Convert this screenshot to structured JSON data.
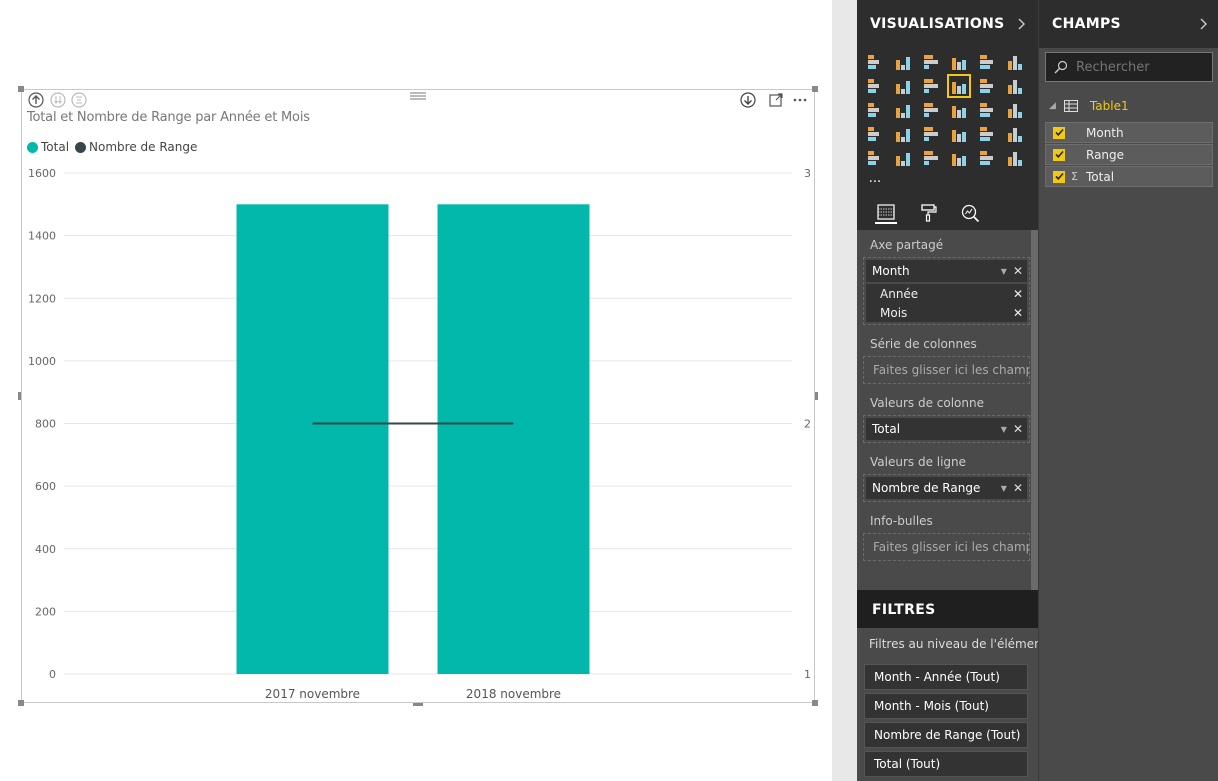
{
  "visual": {
    "title": "Total et Nombre de Range par Année et Mois",
    "legend": [
      {
        "label": "Total",
        "color": "#01b8aa"
      },
      {
        "label": "Nombre de Range",
        "color": "#374649"
      }
    ],
    "toolbar_icons": [
      "drill-up-icon",
      "drill-down-all-icon",
      "expand-all-icon",
      "drill-mode-icon",
      "focus-mode-icon",
      "more-options-icon"
    ]
  },
  "chart_data": {
    "type": "bar",
    "categories": [
      "2017 novembre",
      "2018 novembre"
    ],
    "series": [
      {
        "name": "Total",
        "type": "bar",
        "axis": "left",
        "values": [
          1500,
          1500
        ],
        "color": "#01b8aa"
      },
      {
        "name": "Nombre de Range",
        "type": "line",
        "axis": "right",
        "values": [
          2,
          2
        ],
        "color": "#374649"
      }
    ],
    "title": "Total et Nombre de Range par Année et Mois",
    "ylim": [
      0,
      1600
    ],
    "y2lim": [
      1,
      3
    ],
    "yticks": [
      "0",
      "200",
      "400",
      "600",
      "800",
      "1000",
      "1200",
      "1400",
      "1600"
    ],
    "y2ticks": [
      "1",
      "2",
      "3"
    ],
    "grid": true,
    "legend_position": "top-left"
  },
  "viz_pane": {
    "title": "VISUALISATIONS",
    "icons": [
      "stacked-bar-icon",
      "stacked-column-icon",
      "clustered-bar-icon",
      "clustered-column-icon",
      "100-bar-icon",
      "100-column-icon",
      "line-chart-icon",
      "area-chart-icon",
      "stacked-area-icon",
      "line-clustered-column-icon",
      "line-stacked-column-icon",
      "ribbon-chart-icon",
      "waterfall-icon",
      "scatter-icon",
      "pie-icon",
      "donut-icon",
      "treemap-icon",
      "map-icon",
      "filled-map-icon",
      "shape-map-icon",
      "funnel-icon",
      "gauge-icon",
      "card-icon",
      "multirow-card-icon",
      "kpi-icon",
      "slicer-icon",
      "table-icon",
      "matrix-icon",
      "r-visual-icon",
      "globe-icon"
    ],
    "more": "···",
    "selected_icon": "line-clustered-column-icon",
    "wells": {
      "shared_axis": {
        "label": "Axe partagé",
        "field": "Month",
        "subfields": [
          "Année",
          "Mois"
        ]
      },
      "column_series": {
        "label": "Série de colonnes",
        "placeholder": "Faites glisser ici les champs ..."
      },
      "column_values": {
        "label": "Valeurs de colonne",
        "field": "Total"
      },
      "line_values": {
        "label": "Valeurs de ligne",
        "field": "Nombre de Range"
      },
      "tooltips": {
        "label": "Info-bulles",
        "placeholder": "Faites glisser ici les champs ..."
      }
    }
  },
  "filters": {
    "title": "FILTRES",
    "subtitle": "Filtres au niveau de l'élément...",
    "items": [
      "Month - Année  (Tout)",
      "Month - Mois  (Tout)",
      "Nombre de Range  (Tout)",
      "Total  (Tout)"
    ]
  },
  "fields_pane": {
    "title": "CHAMPS",
    "search_placeholder": "Rechercher",
    "table": "Table1",
    "fields": [
      {
        "name": "Month",
        "checked": true,
        "sigma": false
      },
      {
        "name": "Range",
        "checked": true,
        "sigma": false
      },
      {
        "name": "Total",
        "checked": true,
        "sigma": true
      }
    ]
  }
}
